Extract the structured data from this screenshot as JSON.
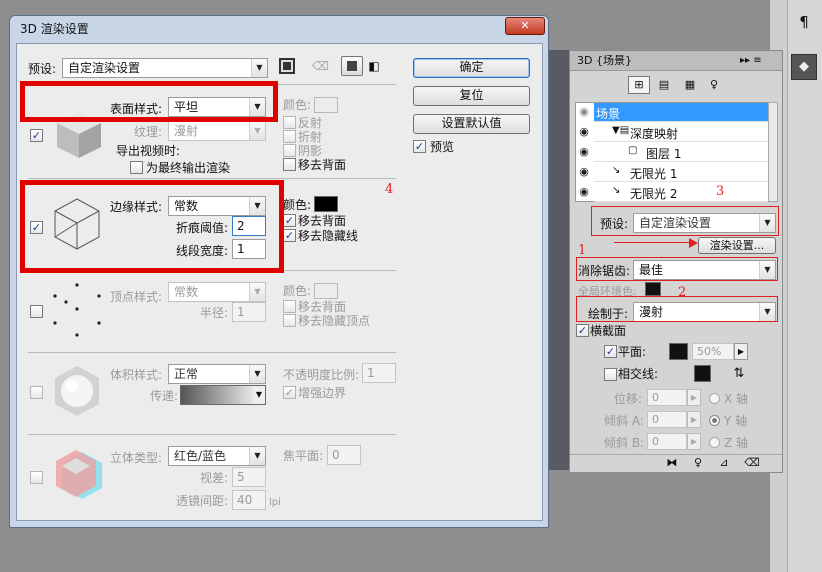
{
  "dialog": {
    "title": "3D 渲染设置",
    "close_label": "✕",
    "preset_label": "预设:",
    "preset_value": "自定渲染设置",
    "buttons": {
      "ok": "确定",
      "reset": "复位",
      "set_default": "设置默认值"
    },
    "preview_label": "预览",
    "preview_check": "✓",
    "face": {
      "check": "✓",
      "style_label": "表面样式:",
      "style_value": "平坦",
      "color_label": "颜色:",
      "texture_label": "纹理:",
      "texture_value": "漫射",
      "export_video_label": "导出视频时:",
      "final_output_label": "为最终输出渲染",
      "reflect_label": "反射",
      "refract_label": "折射",
      "shadow_label": "阴影",
      "remove_back_label": "移去背面"
    },
    "edge": {
      "check": "✓",
      "style_label": "边缘样式:",
      "style_value": "常数",
      "color_label": "颜色:",
      "color_value": "#000000",
      "crease_label": "折痕阈值:",
      "crease_value": "2",
      "width_label": "线段宽度:",
      "width_value": "1",
      "remove_back_label": "移去背面",
      "remove_back_check": "✓",
      "remove_hidden_label": "移去隐藏线",
      "remove_hidden_check": "✓"
    },
    "vertex": {
      "style_label": "顶点样式:",
      "style_value": "常数",
      "color_label": "颜色:",
      "radius_label": "半径:",
      "radius_value": "1",
      "remove_back_label": "移去背面",
      "remove_hidden_label": "移去隐藏顶点"
    },
    "volume": {
      "style_label": "体积样式:",
      "style_value": "正常",
      "opacity_label": "不透明度比例:",
      "opacity_value": "1",
      "transfer_label": "传递:",
      "enhance_label": "增强边界",
      "enhance_check": "✓"
    },
    "stereo": {
      "type_label": "立体类型:",
      "type_value": "红色/蓝色",
      "focal_label": "焦平面:",
      "focal_value": "0",
      "parallax_label": "视差:",
      "parallax_value": "5",
      "lens_label": "透镜间距:",
      "lens_value": "40",
      "lens_unit": "lpi"
    }
  },
  "panel": {
    "tab_title": "3D {场景}",
    "tab_controls": "▸▸ ≡",
    "tree": [
      {
        "label": "场景",
        "indent": 0,
        "selected": true
      },
      {
        "label": "深度映射",
        "indent": 1,
        "selected": false
      },
      {
        "label": "图层 1",
        "indent": 2,
        "selected": false
      },
      {
        "label": "无限光 1",
        "indent": 1,
        "selected": false
      },
      {
        "label": "无限光 2",
        "indent": 1,
        "selected": false
      }
    ],
    "preset_label": "预设:",
    "preset_value": "自定渲染设置",
    "render_settings_button": "渲染设置...",
    "antialias_label": "消除锯齿:",
    "antialias_value": "最佳",
    "global_ambient_label": "全局环境色:",
    "draw_on_label": "绘制于:",
    "draw_on_value": "漫射",
    "cross_section_label": "横截面",
    "cross_section_check": "✓",
    "plane_label": "平面:",
    "plane_check": "✓",
    "plane_percent": "50%",
    "intersect_label": "相交线:",
    "offset_label": "位移:",
    "offset_value": "0",
    "tilt_a_label": "倾斜 A:",
    "tilt_a_value": "0",
    "tilt_b_label": "倾斜 B:",
    "tilt_b_value": "0",
    "axis_x": "X 轴",
    "axis_y": "Y 轴",
    "axis_z": "Z 轴"
  },
  "annotations": {
    "n1": "1",
    "n2": "2",
    "n3": "3",
    "n4": "4"
  },
  "colors": {
    "red_box": "#e00000",
    "selection": "#3399ff",
    "title_bar": "#bcd2ea"
  }
}
